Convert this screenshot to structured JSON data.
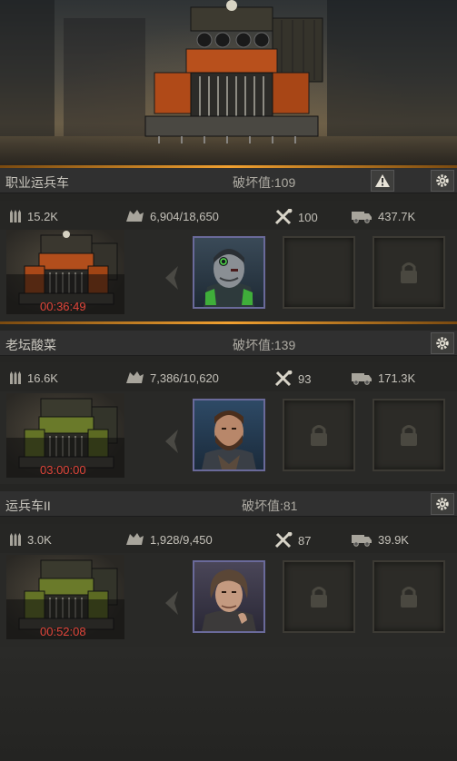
{
  "squads": [
    {
      "name": "职业运兵车",
      "destroy": "破坏值:109",
      "has_warning": true,
      "ammo": "15.2K",
      "durability": "6,904/18,650",
      "repair": "100",
      "load": "437.7K",
      "timer": "00:36:49",
      "truck_color": "orange",
      "hero": "cyborg-hero",
      "slots": [
        "empty",
        "locked"
      ]
    },
    {
      "name": "老坛酸菜",
      "destroy": "破坏值:139",
      "has_warning": false,
      "ammo": "16.6K",
      "durability": "7,386/10,620",
      "repair": "93",
      "load": "171.3K",
      "timer": "03:00:00",
      "truck_color": "green",
      "hero": "bearded-hero",
      "slots": [
        "locked",
        "locked"
      ]
    },
    {
      "name": "运兵车II",
      "destroy": "破坏值:81",
      "has_warning": false,
      "ammo": "3.0K",
      "durability": "1,928/9,450",
      "repair": "87",
      "load": "39.9K",
      "timer": "00:52:08",
      "truck_color": "green",
      "hero": "long-hair-hero",
      "slots": [
        "locked",
        "locked"
      ]
    }
  ],
  "colors": {
    "accent": "#f0a030",
    "timer": "#e0453a",
    "hero_border": "#6a6a9a"
  }
}
